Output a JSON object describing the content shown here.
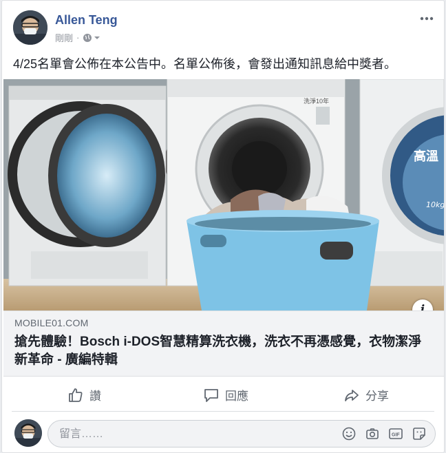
{
  "post": {
    "author": "Allen Teng",
    "timestamp": "剛剛",
    "separator": "·",
    "privacy_icon": "globe-icon",
    "text": "4/25名單會公佈在本公告中。名單公佈後，會發出通知訊息給中獎者。"
  },
  "link_preview": {
    "domain": "MOBILE01.COM",
    "title": "搶先體驗！Bosch i-DOS智慧精算洗衣機，洗衣不再憑感覺，衣物潔淨新革命 - 廣編特輯",
    "info_label": "i"
  },
  "photo": {
    "label_top_center": "洗淨10年",
    "label_right": "高溫",
    "label_speed": "10kg"
  },
  "actions": {
    "like": "讚",
    "comment": "回應",
    "share": "分享"
  },
  "comment": {
    "placeholder": "留言……"
  },
  "colors": {
    "name_blue": "#385898",
    "meta_gray": "#90949c",
    "text": "#1d2129",
    "basket_blue": "#7ec3e6"
  }
}
